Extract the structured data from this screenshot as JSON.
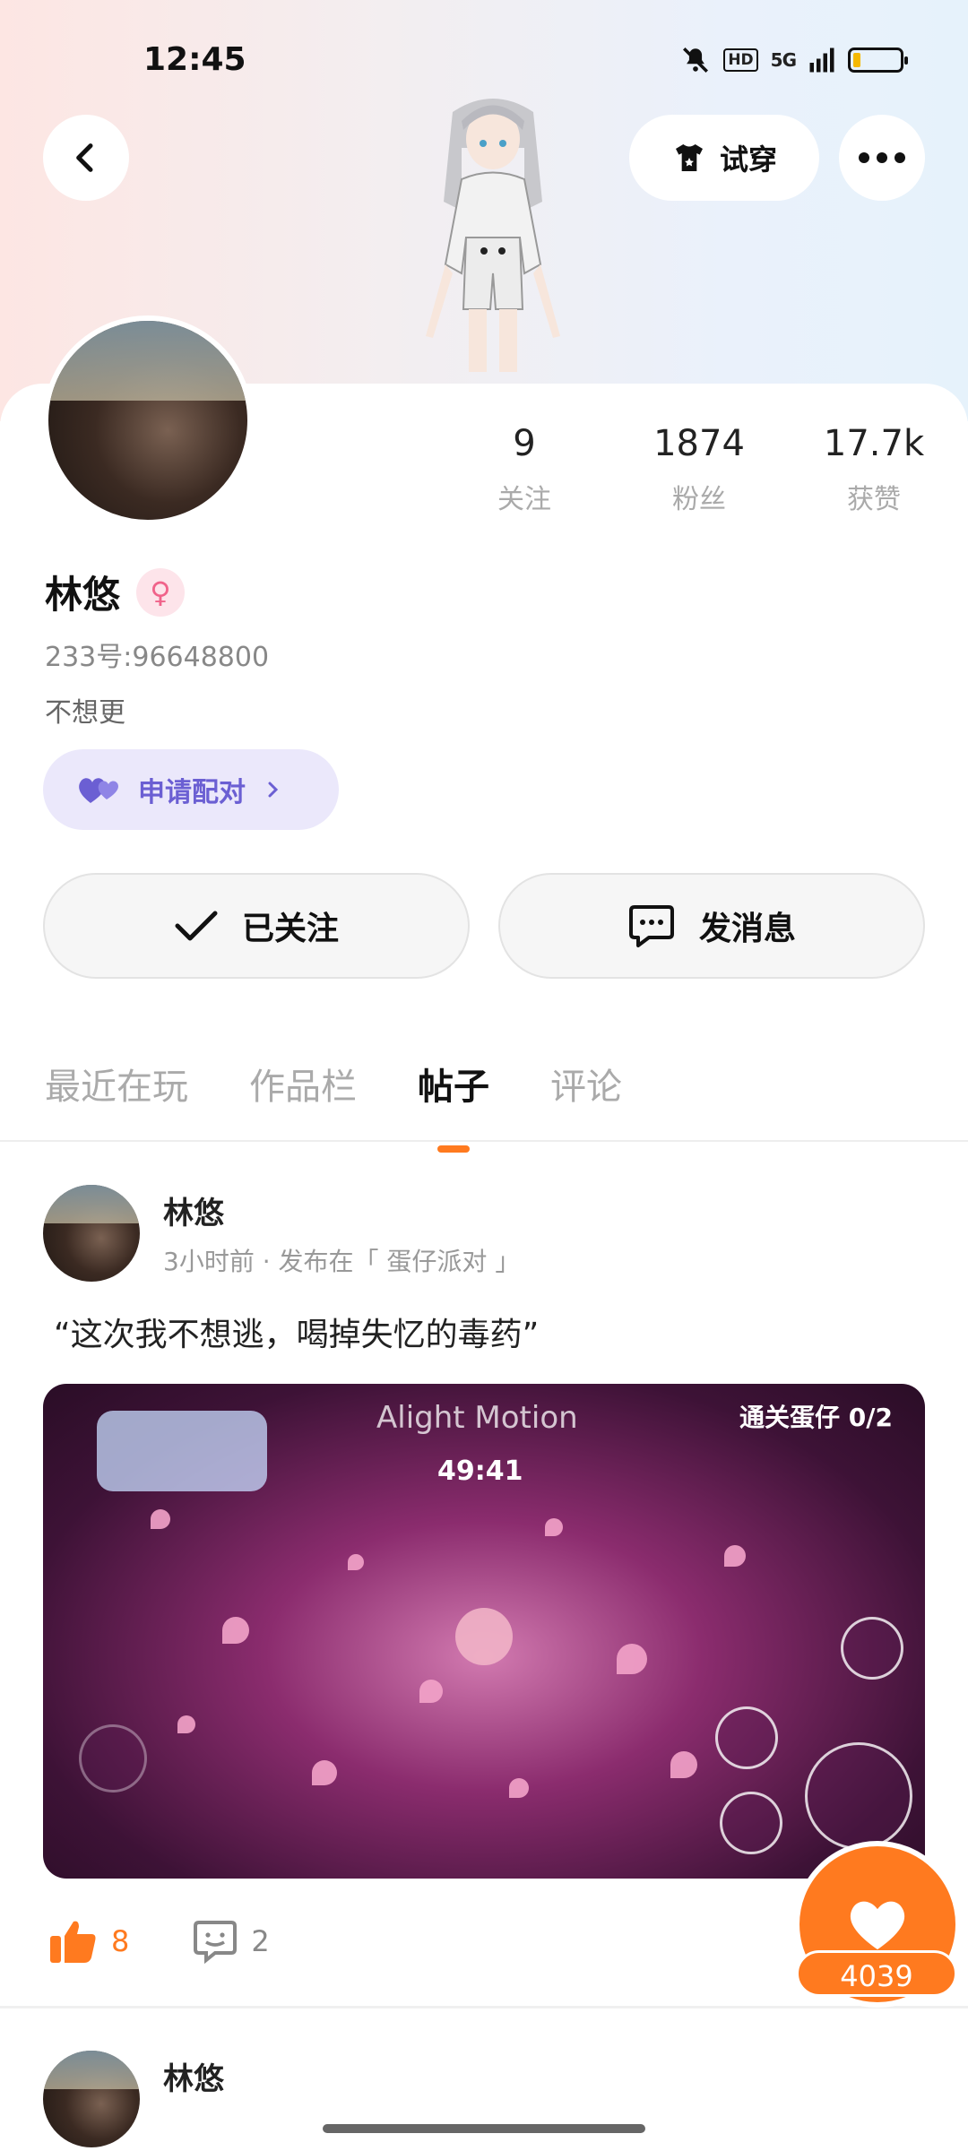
{
  "status_bar": {
    "time": "12:45",
    "hd": "HD",
    "signal": "5G",
    "icons": [
      "mute-icon",
      "hd-icon",
      "signal-5g-icon",
      "battery-icon"
    ]
  },
  "header": {
    "try_on_label": "试穿"
  },
  "profile": {
    "name": "林悠",
    "uid": "233号:96648800",
    "bio": "不想更",
    "pair_label": "申请配对",
    "stats": [
      {
        "num": "9",
        "label": "关注"
      },
      {
        "num": "1874",
        "label": "粉丝"
      },
      {
        "num": "17.7k",
        "label": "获赞"
      }
    ]
  },
  "actions": {
    "follow_label": "已关注",
    "message_label": "发消息"
  },
  "tabs": [
    "最近在玩",
    "作品栏",
    "帖子",
    "评论"
  ],
  "active_tab": "帖子",
  "post": {
    "author": "林悠",
    "meta": "3小时前 · 发布在「 蛋仔派对 」",
    "text": "“这次我不想逃，喝掉失忆的毒药”",
    "media": {
      "title": "Alight Motion",
      "timer": "49:41",
      "goal": "通关蛋仔 0/2"
    },
    "likes": "8",
    "comments": "2"
  },
  "next_post": {
    "author": "林悠"
  },
  "fab": {
    "count": "4039"
  },
  "colors": {
    "accent": "#ff7a1f",
    "pair": "#6b5fd3",
    "gender": "#f0638a"
  }
}
